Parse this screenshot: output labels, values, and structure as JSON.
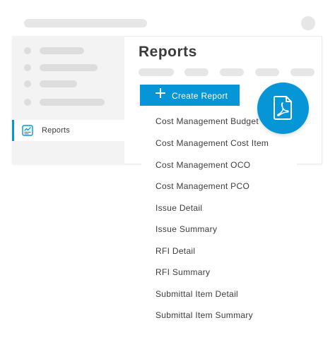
{
  "sidebar": {
    "active_item": {
      "label": "Reports",
      "icon": "report-chart-icon"
    }
  },
  "main": {
    "title": "Reports",
    "create_button": {
      "label": "Create Report",
      "icon": "plus-icon"
    },
    "report_menu": [
      "Cost Management Budget",
      "Cost Management Cost Item",
      "Cost Management OCO",
      "Cost Management PCO",
      "Issue Detail",
      "Issue Summary",
      "RFI Detail",
      "RFI Summary",
      "Submittal Item Detail",
      "Submittal Item Summary"
    ],
    "badge": {
      "icon": "pdf-document-icon"
    }
  },
  "colors": {
    "accent": "#0696d7",
    "placeholder": "#e6e6e6",
    "sidebar_bg": "#f3f3f3",
    "text": "#3c3c3c"
  }
}
